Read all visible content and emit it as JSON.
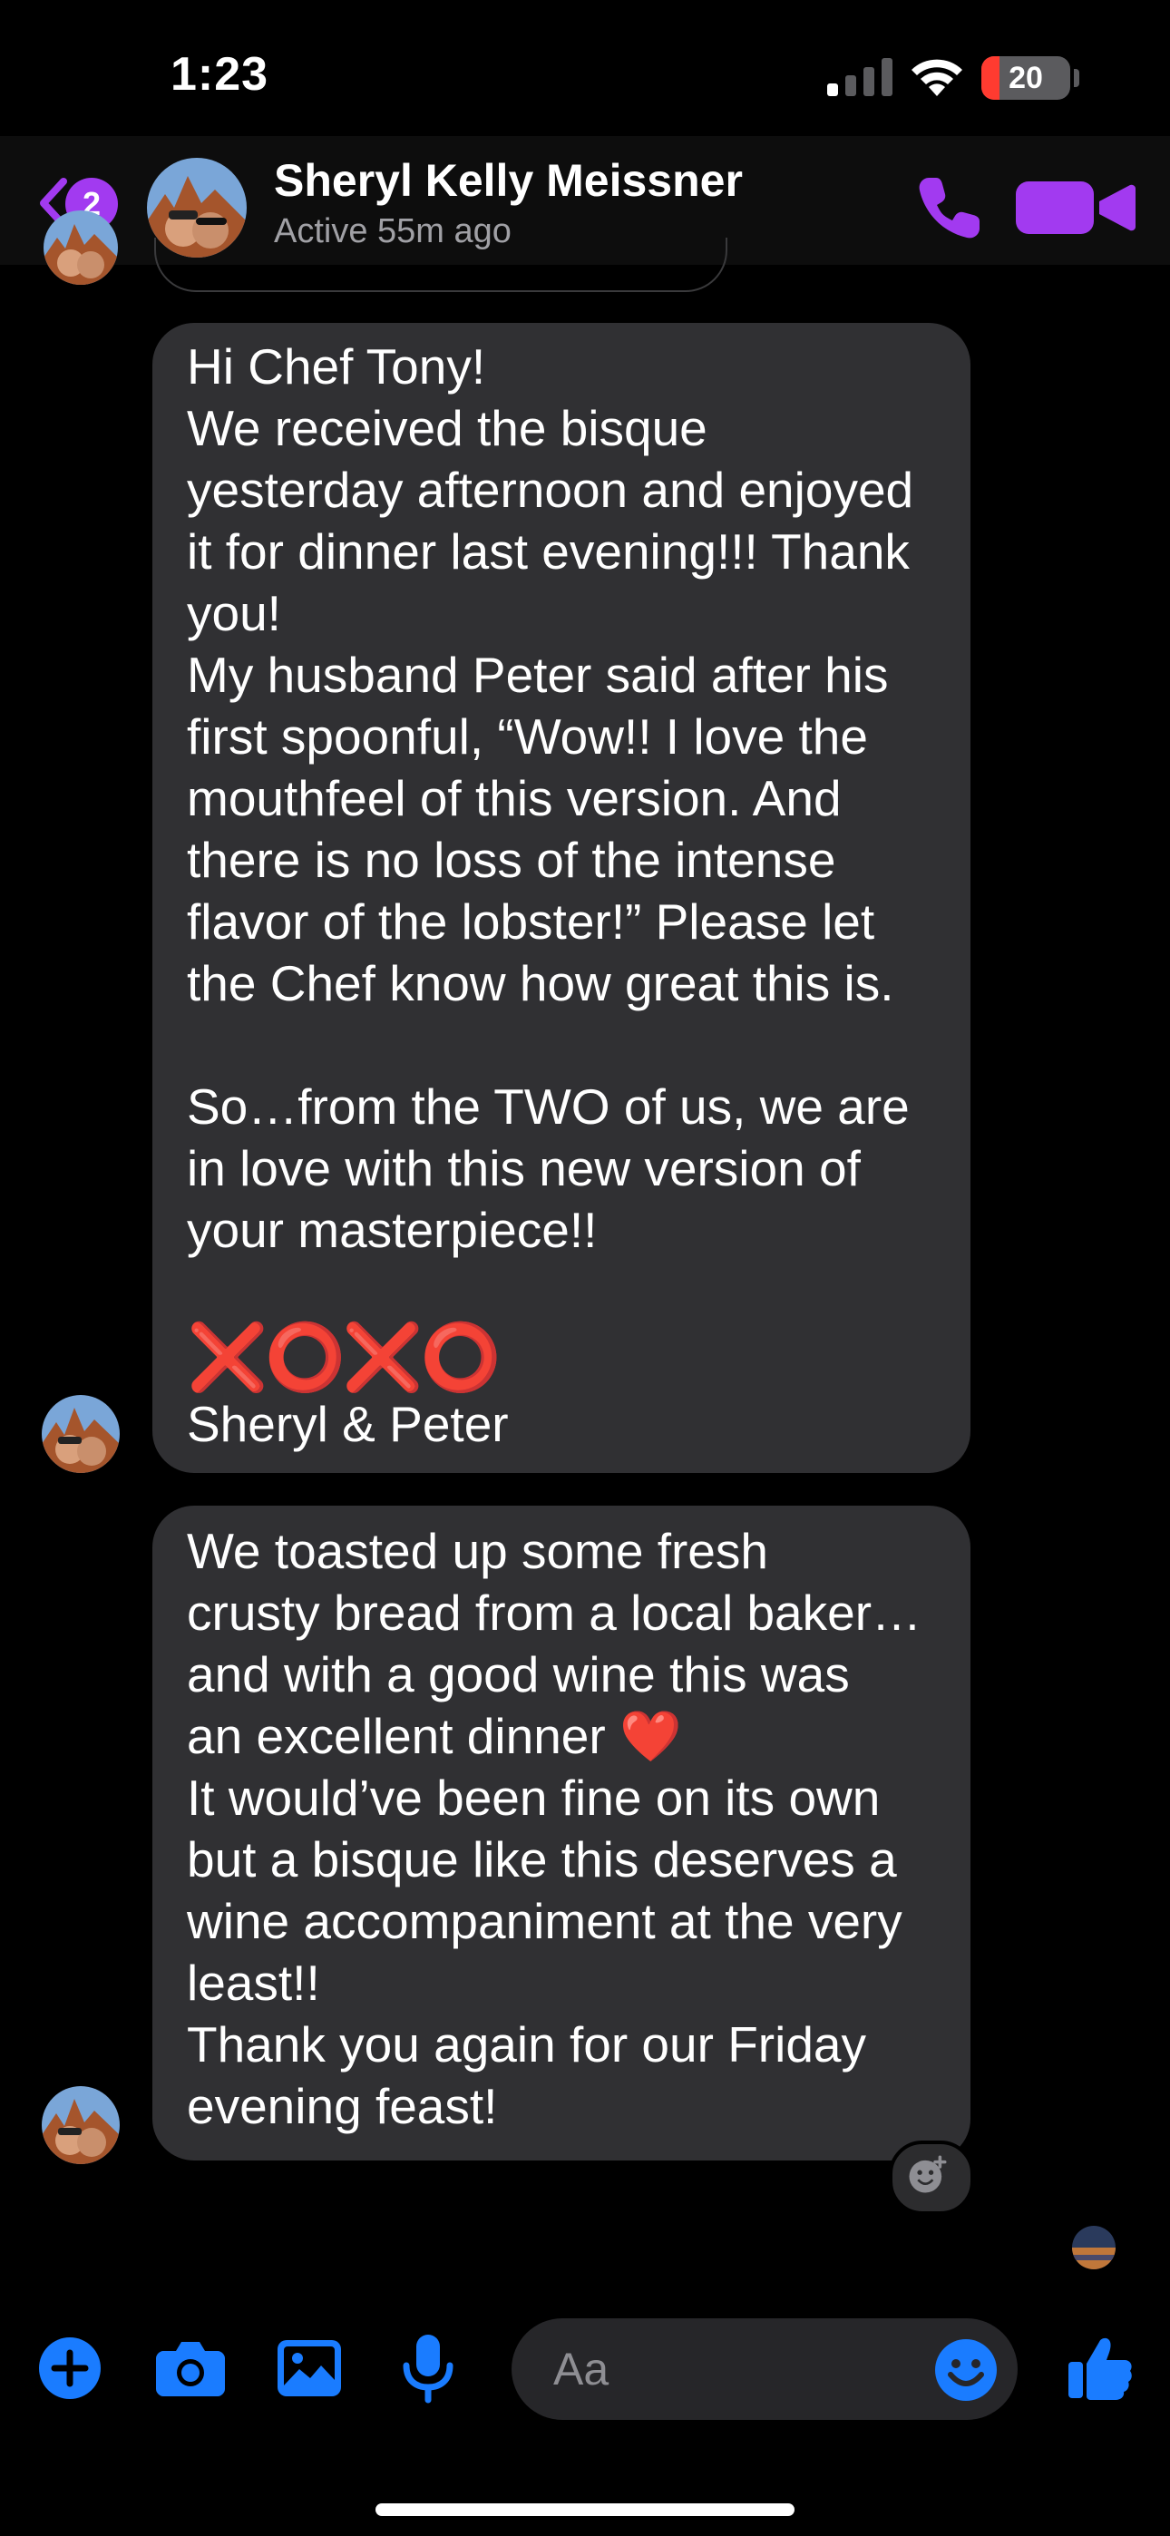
{
  "status_bar": {
    "time": "1:23",
    "battery_level": "20",
    "battery_fraction": 0.2
  },
  "header": {
    "back_badge": "2",
    "contact_name": "Sheryl Kelly Meissner",
    "contact_status": "Active 55m ago"
  },
  "messages": [
    {
      "sender": "contact",
      "lines": [
        "Hi Chef Tony!",
        "We received the bisque",
        "yesterday afternoon and enjoyed",
        "it for dinner last evening!!! Thank",
        "you!",
        "My husband Peter said after his",
        "first spoonful, “Wow!! I love the",
        "mouthfeel of this version. And",
        "there is no loss of the intense",
        "flavor of the lobster!” Please let",
        "the Chef know how great this is.",
        "",
        "So…from the TWO of us, we are",
        "in love with this new version of",
        "your masterpiece!!",
        "",
        "❌⭕❌⭕",
        "Sheryl & Peter"
      ]
    },
    {
      "sender": "contact",
      "lines": [
        "We toasted up some fresh",
        "crusty bread from a local baker…",
        "and with a good wine this was",
        "an excellent dinner ❤️",
        "It would’ve been fine on its own",
        "but a bisque like this deserves a",
        "wine accompaniment at the very",
        "least!!",
        "Thank you again for our Friday",
        "evening feast!"
      ]
    }
  ],
  "composer": {
    "placeholder": "Aa"
  },
  "colors": {
    "accent_purple": "#a23af0",
    "accent_blue": "#1a7cff",
    "bubble_bg": "#303033",
    "red": "#e01b1b"
  },
  "icons": [
    "back-chevron-icon",
    "phone-icon",
    "video-camera-icon",
    "plus-icon",
    "camera-icon",
    "photo-icon",
    "microphone-icon",
    "emoji-icon",
    "thumbs-up-icon",
    "add-reaction-icon"
  ]
}
